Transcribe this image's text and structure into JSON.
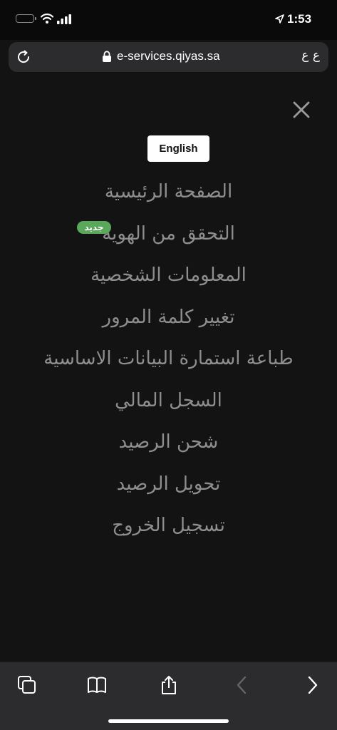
{
  "status_bar": {
    "time": "1:53",
    "icons": [
      "battery-icon",
      "wifi-icon",
      "cellular-signal-icon",
      "location-arrow-icon"
    ]
  },
  "browser": {
    "url": "e-services.qiyas.sa",
    "text_size_label": "ع ع",
    "icons": [
      "reload-icon",
      "lock-icon"
    ]
  },
  "menu_panel": {
    "close_icon": "close-icon",
    "language_button": "English",
    "items": [
      {
        "label": "الصفحة الرئيسية"
      },
      {
        "label": "التحقق من الهوية",
        "badge": "جديد"
      },
      {
        "label": "المعلومات الشخصية"
      },
      {
        "label": "تغيير كلمة المرور"
      },
      {
        "label": "طباعة استمارة البيانات الاساسية"
      },
      {
        "label": "السجل المالي"
      },
      {
        "label": "شحن الرصيد"
      },
      {
        "label": "تحويل الرصيد"
      },
      {
        "label": "تسجيل الخروج"
      }
    ],
    "colors": {
      "background": "#131313",
      "item_text": "#8e8e8e",
      "badge": "#5ba85c",
      "button_bg": "#ffffff"
    }
  },
  "toolbar": {
    "icons": [
      "tabs-icon",
      "bookmarks-icon",
      "share-icon",
      "back-icon",
      "forward-icon"
    ]
  }
}
